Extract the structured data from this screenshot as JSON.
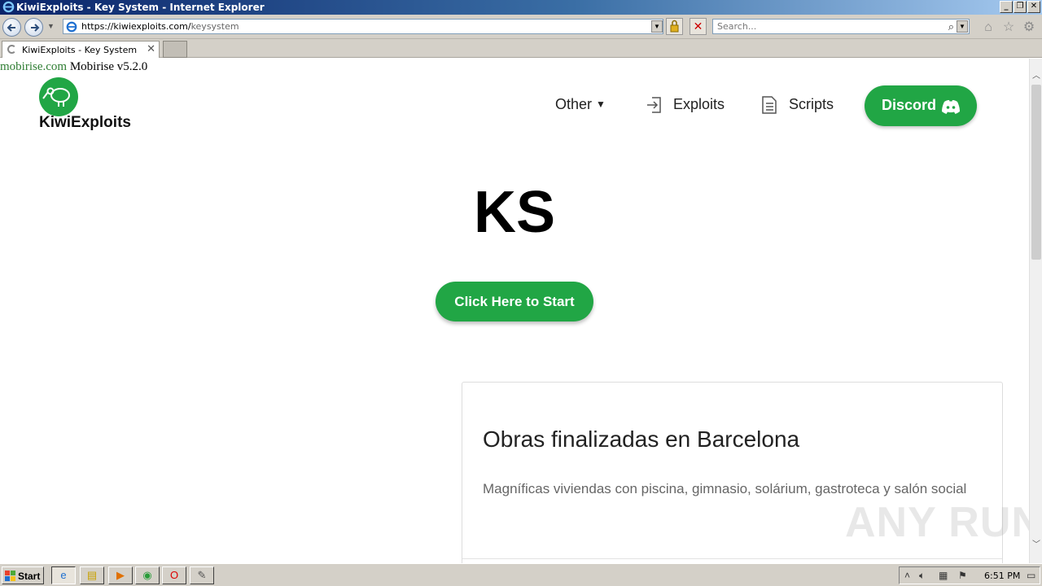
{
  "window": {
    "title": "KiwiExploits - Key System - Internet Explorer"
  },
  "addressbar": {
    "url_host": "https://kiwiexploits.com/",
    "url_path": "keysystem",
    "search_placeholder": "Search..."
  },
  "tabs": [
    {
      "label": "KiwiExploits - Key System"
    }
  ],
  "page": {
    "mobirise_link": "mobirise.com",
    "mobirise_version": " Mobirise v5.2.0",
    "brand": "KiwiExploits",
    "nav": {
      "other": "Other",
      "exploits": "Exploits",
      "scripts": "Scripts",
      "discord": "Discord"
    },
    "hero_title": "KS",
    "start_button": "Click Here to Start",
    "card": {
      "title": "Obras finalizadas en Barcelona",
      "text": "Magníficas viviendas con piscina, gimnasio, solárium, gastroteca y salón social"
    },
    "watermark": "ANY RUN"
  },
  "taskbar": {
    "start_label": "Start",
    "clock": "6:51 PM"
  },
  "colors": {
    "accent": "#21a645",
    "titlebar": "#0a246a"
  }
}
